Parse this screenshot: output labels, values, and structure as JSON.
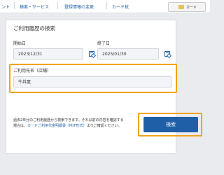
{
  "nav": {
    "items": [
      "ント",
      "検索・サービス",
      "登録情報の変更",
      "カード枚"
    ],
    "card_label": "カード"
  },
  "panel": {
    "title": "ご利用履歴の検索",
    "start": {
      "label": "開始日",
      "value": "2023/12/31"
    },
    "end": {
      "label": "終了日",
      "value": "2025/01/30"
    },
    "merchant": {
      "label": "ご利用先名（店舗）",
      "value": "牛丼屋"
    },
    "note_text": "過去2年分のご利用履歴から検索できます。それ以前の内容を確認する場合は、",
    "note_link": "カードご利用代金明細書（PDF形式）",
    "note_suffix": "よりご確認ください。",
    "search_button": "検索"
  },
  "colors": {
    "accent": "#1f5fa8",
    "highlight": "#f2a31b"
  }
}
